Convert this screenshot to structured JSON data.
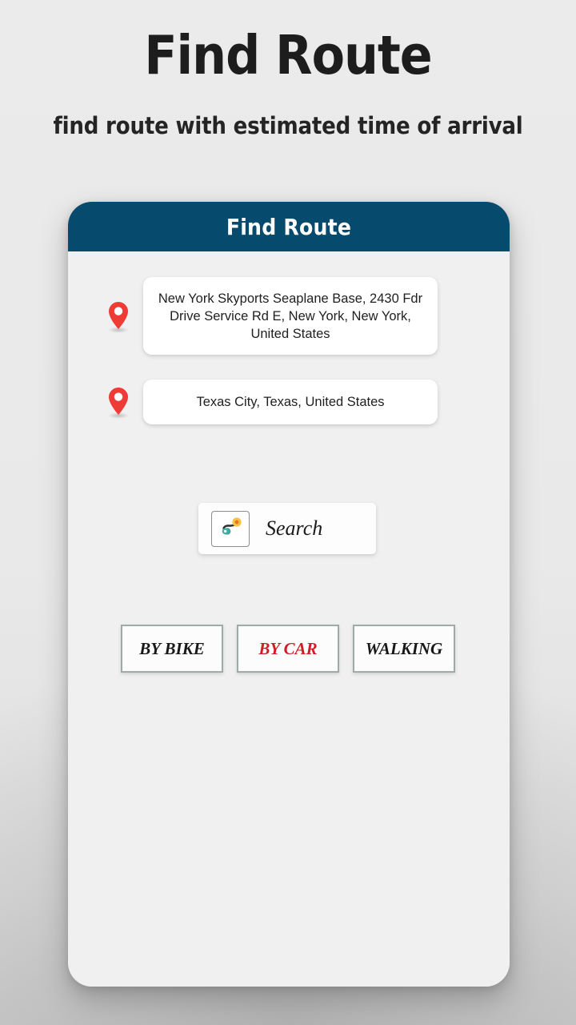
{
  "promo": {
    "title": "Find Route",
    "subtitle": "find route with estimated time of arrival"
  },
  "app": {
    "appbar": {
      "title": "Find Route"
    },
    "origin": {
      "icon": "map-pin-icon",
      "value": "New York Skyports Seaplane Base, 2430 Fdr Drive Service Rd E, New York, New York, United States",
      "placeholder": "Enter start location"
    },
    "destination": {
      "icon": "map-pin-icon",
      "value": "Texas City, Texas, United States",
      "placeholder": "Enter destination"
    },
    "my_location": {
      "icon": "my-location-icon"
    },
    "search": {
      "icon": "route-icon",
      "label": "Search"
    },
    "travel_modes": [
      {
        "label": "BY BIKE",
        "active": false
      },
      {
        "label": "BY CAR",
        "active": true
      },
      {
        "label": "WALKING",
        "active": false
      }
    ]
  },
  "colors": {
    "appbar": "#064a6e",
    "active_mode": "#cc1f24",
    "pin": "#ef3b36",
    "mode_border": "#9dada6",
    "page_bg": "#e9e9e9",
    "card_bg": "#f0f0f0"
  }
}
